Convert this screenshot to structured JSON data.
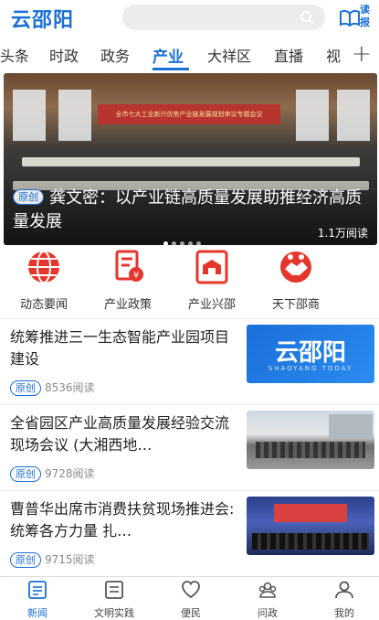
{
  "header": {
    "logo": "云邵阳",
    "read_label": "读报"
  },
  "tabs": [
    {
      "label": "头条"
    },
    {
      "label": "时政"
    },
    {
      "label": "政务"
    },
    {
      "label": "产业",
      "active": true
    },
    {
      "label": "大祥区"
    },
    {
      "label": "直播"
    },
    {
      "label": "视"
    }
  ],
  "banner": {
    "badge": "原创",
    "title": "龚文密：以产业链高质量发展助推经济高质量发展",
    "reads": "1.1万阅读",
    "screen_text": "全市七大工业新兴优势产业链发展规划审议专题会议",
    "dots": 5,
    "active_dot": 0
  },
  "quick_links": [
    {
      "label": "动态要闻",
      "icon": "globe-icon"
    },
    {
      "label": "产业政策",
      "icon": "policy-icon"
    },
    {
      "label": "产业兴邵",
      "icon": "industry-icon"
    },
    {
      "label": "天下邵商",
      "icon": "handshake-icon"
    }
  ],
  "news": [
    {
      "title": "统筹推进三一生态智能产业园项目建设",
      "badge": "原创",
      "reads": "8536阅读",
      "thumb": "logo",
      "thumb_text": "云邵阳",
      "thumb_sub": "SHAOYANG TODAY"
    },
    {
      "title": "全省园区产业高质量发展经验交流现场会议 (大湘西地…",
      "badge": "原创",
      "reads": "9728阅读",
      "thumb": "crowd"
    },
    {
      "title": "曹普华出席市消费扶贫现场推进会:统筹各方力量  扎…",
      "badge": "原创",
      "reads": "9715阅读",
      "thumb": "stage"
    }
  ],
  "tabbar": [
    {
      "label": "新闻",
      "icon": "news-icon",
      "active": true
    },
    {
      "label": "文明实践",
      "icon": "civil-icon"
    },
    {
      "label": "便民",
      "icon": "heart-icon"
    },
    {
      "label": "问政",
      "icon": "people-icon"
    },
    {
      "label": "我的",
      "icon": "user-icon"
    }
  ],
  "colors": {
    "accent": "#1a6fd8",
    "icon_red": "#e5362c"
  }
}
